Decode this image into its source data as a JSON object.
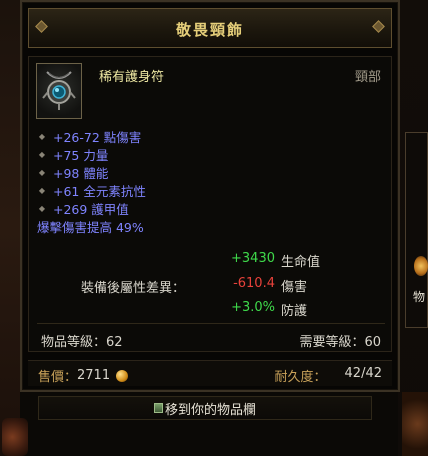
{
  "item": {
    "title": "敬畏頸飾",
    "name": "稀有護身符",
    "slot": "頸部",
    "affixes": [
      {
        "text": "+26-72 點傷害",
        "bulleted": true
      },
      {
        "text": "+75 力量",
        "bulleted": true
      },
      {
        "text": "+98 體能",
        "bulleted": true
      },
      {
        "text": "+61 全元素抗性",
        "bulleted": true
      },
      {
        "text": "+269 護甲值",
        "bulleted": true
      },
      {
        "text": "爆擊傷害提高 49%",
        "bulleted": false
      }
    ],
    "compare": {
      "label": "裝備後屬性差異：",
      "rows": [
        {
          "value": "+3430",
          "stat": "生命值",
          "sign": "pos"
        },
        {
          "value": "-610.4",
          "stat": "傷害",
          "sign": "neg"
        },
        {
          "value": "+3.0%",
          "stat": "防護",
          "sign": "pos"
        }
      ]
    },
    "item_level": "物品等級：62",
    "required_level": "需要等級：60",
    "price_label": "售價：",
    "price_value": "2711",
    "durability_label": "耐久度：",
    "durability_value": "42/42"
  },
  "actions": {
    "move_to_inventory": "移到你的物品欄"
  },
  "background": {
    "side_text": "物"
  },
  "icons": {
    "item_icon": "amulet-icon",
    "gold": "gold-coin-icon",
    "inventory": "inventory-bag-icon",
    "bullet": "diamond-bullet-icon"
  },
  "colors": {
    "title": "#e6cf7a",
    "name": "#ece6a2",
    "affix": "#7f84ff",
    "positive": "#3fd94b",
    "negative": "#e8423b",
    "gold_label": "#c9a25a"
  }
}
